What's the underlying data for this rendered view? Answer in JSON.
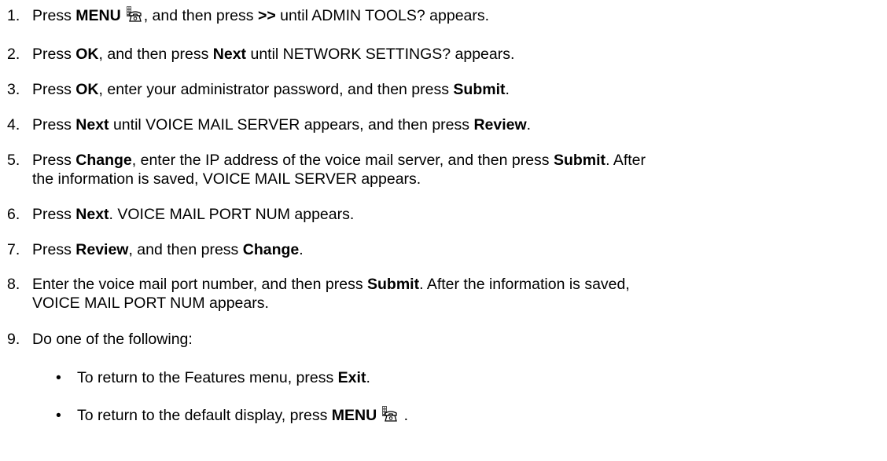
{
  "steps": [
    {
      "n": "1.",
      "parts": [
        "Press ",
        "MENU",
        ", and then press ",
        ">>",
        " until ADMIN TOOLS? appears."
      ]
    },
    {
      "n": "2.",
      "parts": [
        "Press ",
        "OK",
        ", and then press ",
        "Next",
        " until NETWORK SETTINGS? appears."
      ]
    },
    {
      "n": "3.",
      "parts": [
        "Press ",
        "OK",
        ", enter your administrator password, and then press ",
        "Submit",
        "."
      ]
    },
    {
      "n": "4.",
      "parts": [
        "Press ",
        "Next",
        " until VOICE MAIL SERVER appears, and then press ",
        "Review",
        "."
      ]
    },
    {
      "n": "5.",
      "parts": [
        "Press ",
        "Change",
        ", enter the IP address of the voice mail server, and then press ",
        "Submit",
        ". After"
      ],
      "line2": "the information is saved, VOICE MAIL SERVER appears."
    },
    {
      "n": "6.",
      "parts": [
        "Press ",
        "Next",
        ". VOICE MAIL PORT NUM appears."
      ]
    },
    {
      "n": "7.",
      "parts": [
        "Press ",
        "Review",
        ", and then press ",
        "Change",
        "."
      ]
    },
    {
      "n": "8.",
      "parts": [
        "Enter the voice mail port number, and then press ",
        "Submit",
        ". After the information is saved,"
      ],
      "line2": "VOICE MAIL PORT NUM appears."
    },
    {
      "n": "9.",
      "parts": [
        "Do one of the following:"
      ]
    }
  ],
  "bullets": [
    {
      "symbol": "•",
      "parts": [
        "To return to the Features menu, press ",
        "Exit",
        "."
      ]
    },
    {
      "symbol": "•",
      "parts": [
        "To return to the default display, press ",
        "MENU",
        " ."
      ]
    }
  ],
  "icons": {
    "menu_key": "phone-menu-icon"
  }
}
